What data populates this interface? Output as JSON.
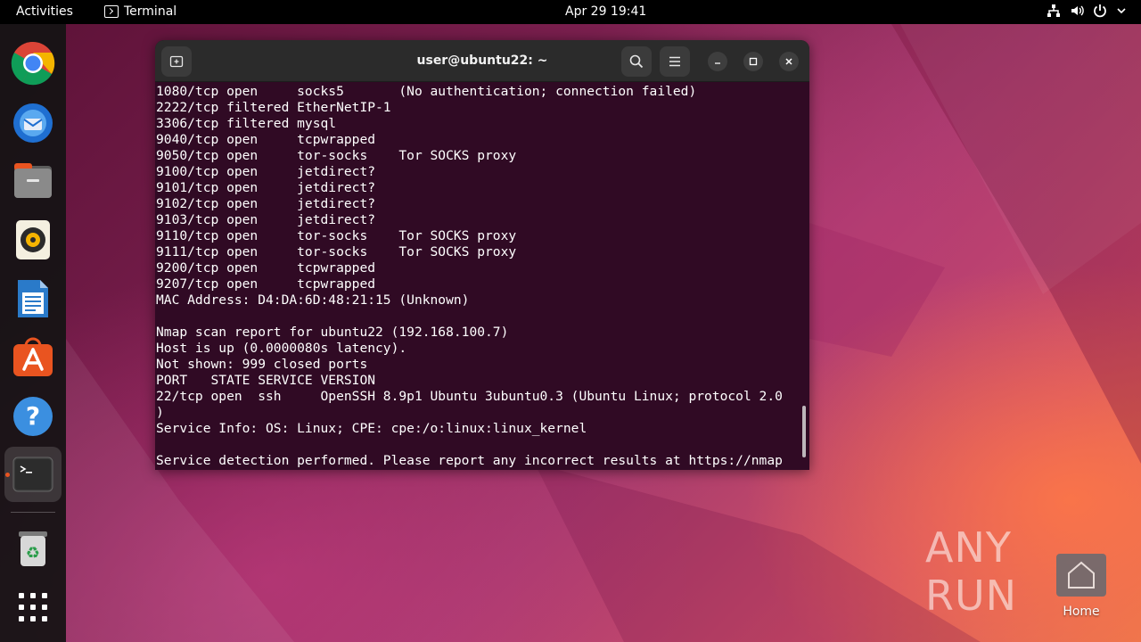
{
  "topbar": {
    "activities": "Activities",
    "app_name": "Terminal",
    "clock": "Apr 29  19:41"
  },
  "dock": {
    "items": [
      "chrome-icon",
      "thunderbird-icon",
      "files-icon",
      "rhythmbox-icon",
      "libreoffice-writer-icon",
      "app-center-icon",
      "help-icon",
      "terminal-icon",
      "trash-icon",
      "show-apps-icon"
    ]
  },
  "terminal": {
    "title": "user@ubuntu22: ~",
    "lines": [
      "1080/tcp open     socks5       (No authentication; connection failed)",
      "2222/tcp filtered EtherNetIP-1",
      "3306/tcp filtered mysql",
      "9040/tcp open     tcpwrapped",
      "9050/tcp open     tor-socks    Tor SOCKS proxy",
      "9100/tcp open     jetdirect?",
      "9101/tcp open     jetdirect?",
      "9102/tcp open     jetdirect?",
      "9103/tcp open     jetdirect?",
      "9110/tcp open     tor-socks    Tor SOCKS proxy",
      "9111/tcp open     tor-socks    Tor SOCKS proxy",
      "9200/tcp open     tcpwrapped",
      "9207/tcp open     tcpwrapped",
      "MAC Address: D4:DA:6D:48:21:15 (Unknown)",
      "",
      "Nmap scan report for ubuntu22 (192.168.100.7)",
      "Host is up (0.0000080s latency).",
      "Not shown: 999 closed ports",
      "PORT   STATE SERVICE VERSION",
      "22/tcp open  ssh     OpenSSH 8.9p1 Ubuntu 3ubuntu0.3 (Ubuntu Linux; protocol 2.0",
      ")",
      "Service Info: OS: Linux; CPE: cpe:/o:linux:linux_kernel",
      "",
      "Service detection performed. Please report any incorrect results at https://nmap"
    ]
  },
  "desktop": {
    "home_label": "Home",
    "watermark": "ANY RUN"
  },
  "colors": {
    "terminal_bg": "#300a24",
    "accent": "#e95420"
  }
}
